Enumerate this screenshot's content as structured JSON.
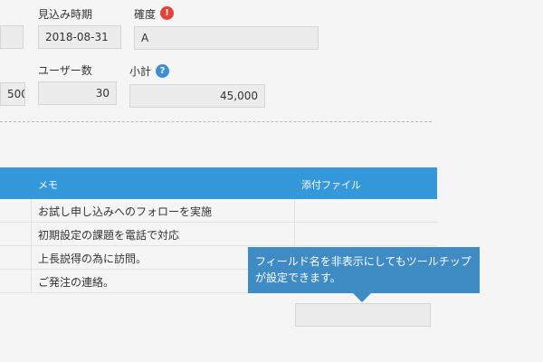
{
  "form": {
    "row1": {
      "expected_date": {
        "label": "見込み時期",
        "value": "2018-08-31"
      },
      "certainty": {
        "label": "確度",
        "value": "A",
        "badge": "!"
      }
    },
    "row2": {
      "unit_price_partial": "500",
      "user_count": {
        "label": "ユーザー数",
        "value": "30"
      },
      "subtotal": {
        "label": "小計",
        "value": "45,000",
        "badge": "?"
      }
    }
  },
  "table": {
    "headers": {
      "memo": "メモ",
      "attachment": "添付ファイル"
    },
    "rows": [
      {
        "memo": "お試し申し込みへのフォローを実施"
      },
      {
        "memo": "初期設定の課題を電話で対応"
      },
      {
        "memo": "上長説得の為に訪問。"
      },
      {
        "memo": "ご発注の連絡。"
      }
    ]
  },
  "tooltip": {
    "text_line1": "フィールド名を非表示にしてもツールチップ",
    "text_line2": "が設定できます。"
  },
  "colors": {
    "header_blue": "#3498db",
    "tooltip_blue": "#3f8bc4",
    "warning_red": "#e0443a",
    "help_blue": "#3c8fd6"
  }
}
